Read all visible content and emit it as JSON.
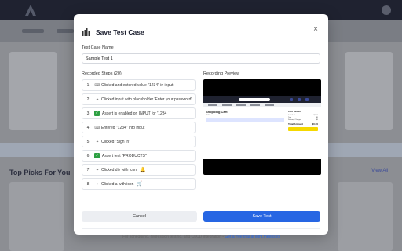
{
  "background": {
    "nav_items": [
      "",
      ""
    ],
    "top_picks": "Top Picks For You",
    "view_all": "View All"
  },
  "modal": {
    "title": "Save Test Case",
    "close_icon": "close-icon",
    "name_label": "Test Case Name",
    "name_value": "Sample Test 1",
    "steps_label": "Recorded Steps (20)",
    "preview_label": "Recording Preview",
    "steps": [
      {
        "num": "1",
        "icon": "keyboard-icon",
        "text": "Clicked and entered value \"1234\" in input",
        "extra": ""
      },
      {
        "num": "2",
        "icon": "cursor-icon",
        "text": "Clicked input with placeholder 'Enter your password'",
        "extra": ""
      },
      {
        "num": "3",
        "icon": "check-icon",
        "text": "Assert is enabled on INPUT for '1234",
        "extra": ""
      },
      {
        "num": "4",
        "icon": "keyboard-icon",
        "text": "Entered \"1234\" into input",
        "extra": ""
      },
      {
        "num": "5",
        "icon": "cursor-icon",
        "text": "Clicked \"Sign In\"",
        "extra": ""
      },
      {
        "num": "6",
        "icon": "check-icon",
        "text": "Assert text \"PRODUCTS\"",
        "extra": ""
      },
      {
        "num": "7",
        "icon": "cursor-icon",
        "text": "Clicked div with icon",
        "extra": "🔔"
      },
      {
        "num": "8",
        "icon": "cursor-icon",
        "text": "Clicked a with icon",
        "extra": "🛒"
      }
    ],
    "preview": {
      "cart_title": "Shopping Cart",
      "cart_sub": "Items",
      "summary_title": "Cart Details",
      "rows": [
        {
          "label": "Sub Total",
          "value": "$0.00"
        },
        {
          "label": "Tax",
          "value": "$0"
        },
        {
          "label": "Delivery Charges",
          "value": "$0"
        }
      ],
      "total_label": "Total Amount",
      "total_value": "$0.00"
    },
    "cancel_label": "Cancel",
    "save_label": "Save Test",
    "footer_text": "For scheduling, regression testing, and CI/CD integration - ",
    "footer_link": "Get a free trial at light.meeris.io"
  }
}
